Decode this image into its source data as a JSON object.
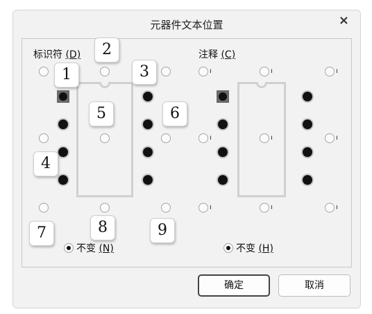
{
  "dialog": {
    "title": "元器件文本位置",
    "close_glyph": "×"
  },
  "identifier": {
    "label": "标识符 ",
    "hotkey": "(D)",
    "unchanged_label": "不变",
    "unchanged_hotkey": "(N)"
  },
  "comment": {
    "label": "注释 ",
    "hotkey": "(C)",
    "unchanged_label": "不变",
    "unchanged_hotkey": "(H)",
    "tick_marks": [
      "ı",
      "ı",
      "ı",
      "ı",
      "ı",
      "ı",
      "ı",
      "ı",
      "ı"
    ]
  },
  "badges": [
    "1",
    "2",
    "3",
    "4",
    "5",
    "6",
    "7",
    "8",
    "9"
  ],
  "buttons": {
    "ok": "确定",
    "cancel": "取消"
  }
}
